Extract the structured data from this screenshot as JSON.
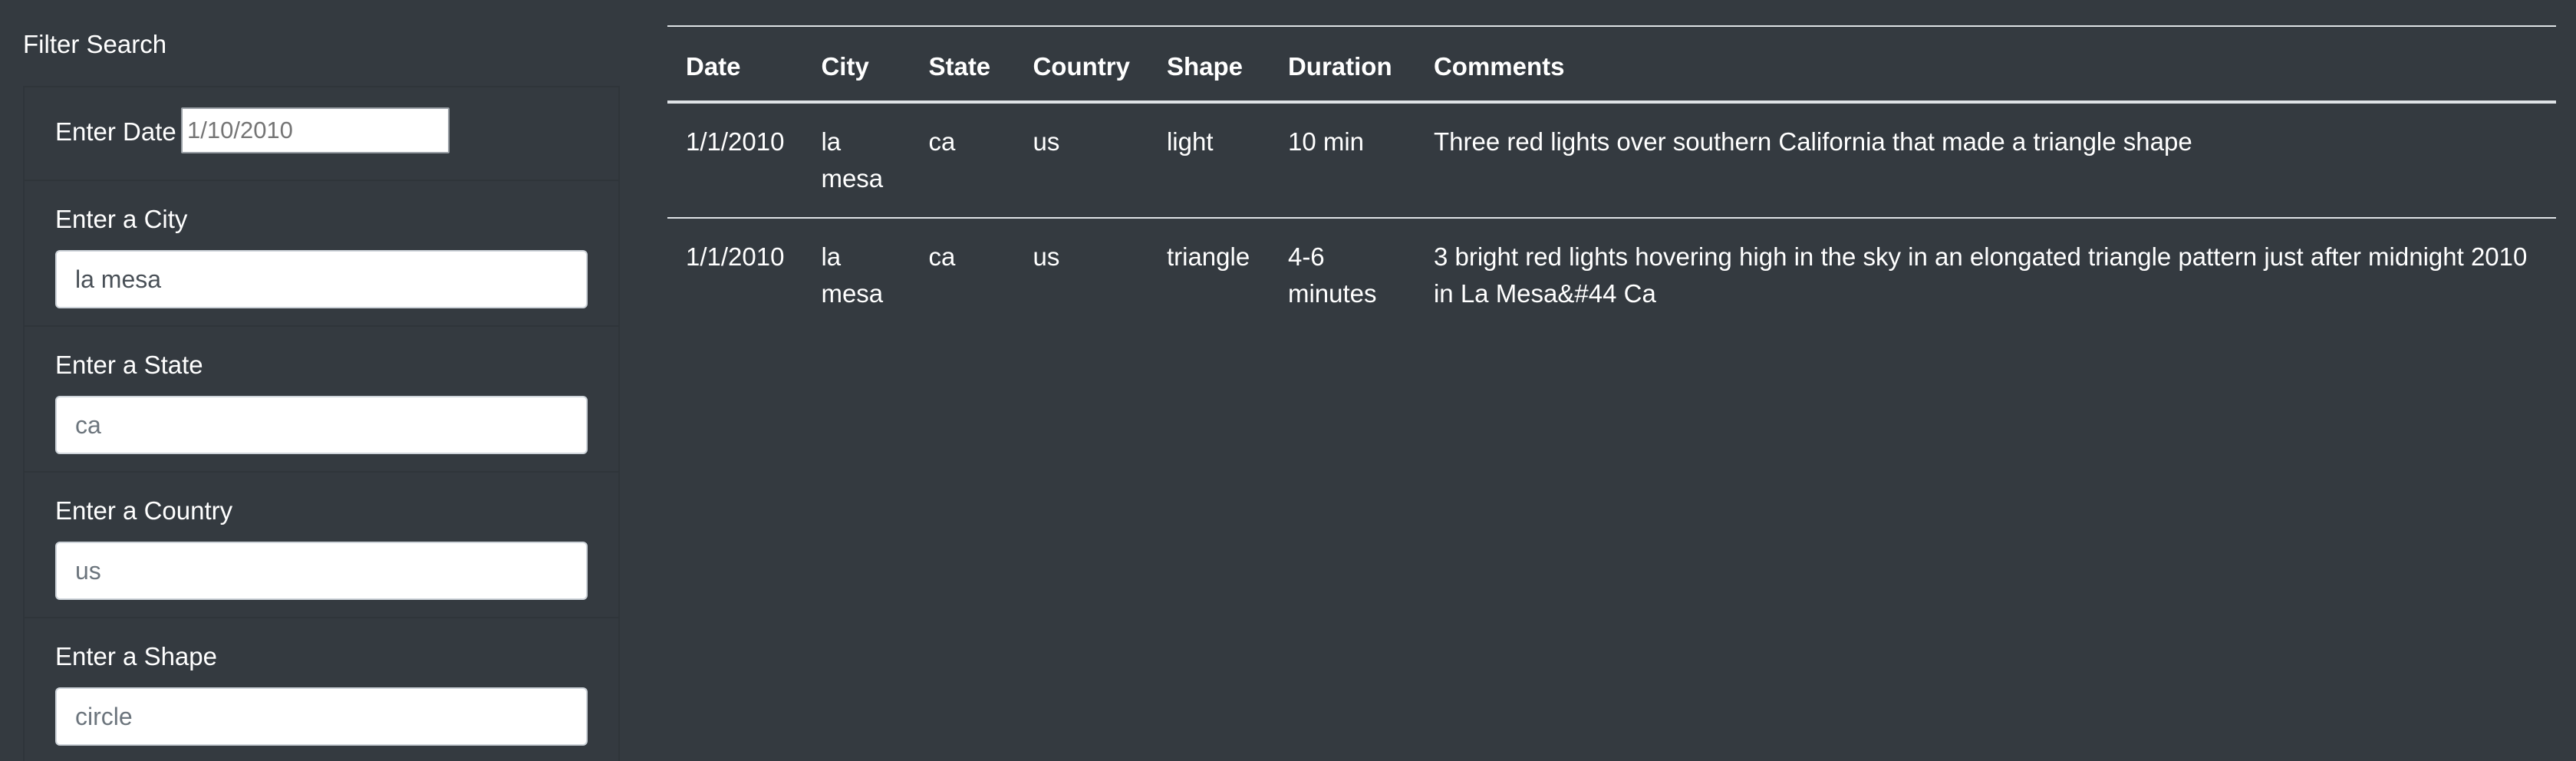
{
  "sidebar": {
    "title": "Filter Search",
    "date": {
      "label": "Enter Date",
      "value": "",
      "placeholder": "1/10/2010"
    },
    "city": {
      "label": "Enter a City",
      "value": "la mesa",
      "placeholder": ""
    },
    "state": {
      "label": "Enter a State",
      "value": "",
      "placeholder": "ca"
    },
    "country": {
      "label": "Enter a Country",
      "value": "",
      "placeholder": "us"
    },
    "shape": {
      "label": "Enter a Shape",
      "value": "",
      "placeholder": "circle"
    }
  },
  "table": {
    "headers": [
      "Date",
      "City",
      "State",
      "Country",
      "Shape",
      "Duration",
      "Comments"
    ],
    "rows": [
      [
        "1/1/2010",
        "la mesa",
        "ca",
        "us",
        "light",
        "10 min",
        "Three red lights over southern California that made a triangle shape"
      ],
      [
        "1/1/2010",
        "la mesa",
        "ca",
        "us",
        "triangle",
        "4-6 minutes",
        "3 bright red lights hovering high in the sky in an elongated triangle pattern just after midnight 2010 in La Mesa&#44 Ca"
      ]
    ]
  },
  "colors": {
    "background": "#343a40",
    "text": "#ffffff",
    "table_border": "#dee2e6"
  }
}
